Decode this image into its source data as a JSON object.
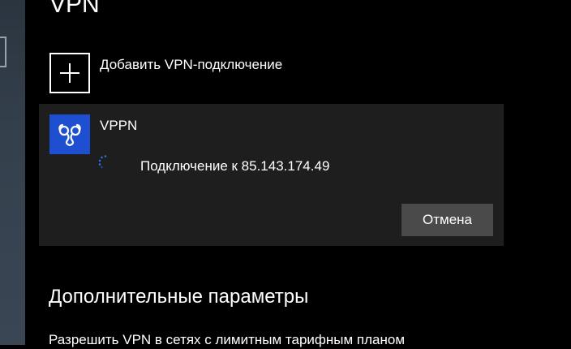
{
  "page": {
    "title": "VPN"
  },
  "add_vpn": {
    "label": "Добавить VPN-подключение",
    "icon": "plus-icon"
  },
  "connection": {
    "name": "VPPN",
    "logo_icon": "vpn-brand-logo-icon",
    "logo_color": "#1e4fd1",
    "status_icon": "loading-spinner-icon",
    "status_text": "Подключение к 85.143.174.49",
    "cancel_label": "Отмена"
  },
  "advanced": {
    "title": "Дополнительные параметры",
    "option_metered": "Разрешить VPN в сетях с лимитным тарифным планом"
  },
  "colors": {
    "background": "#000000",
    "card": "#1e1e1e",
    "button": "#4a4a4a",
    "accent": "#1e4fd1"
  }
}
